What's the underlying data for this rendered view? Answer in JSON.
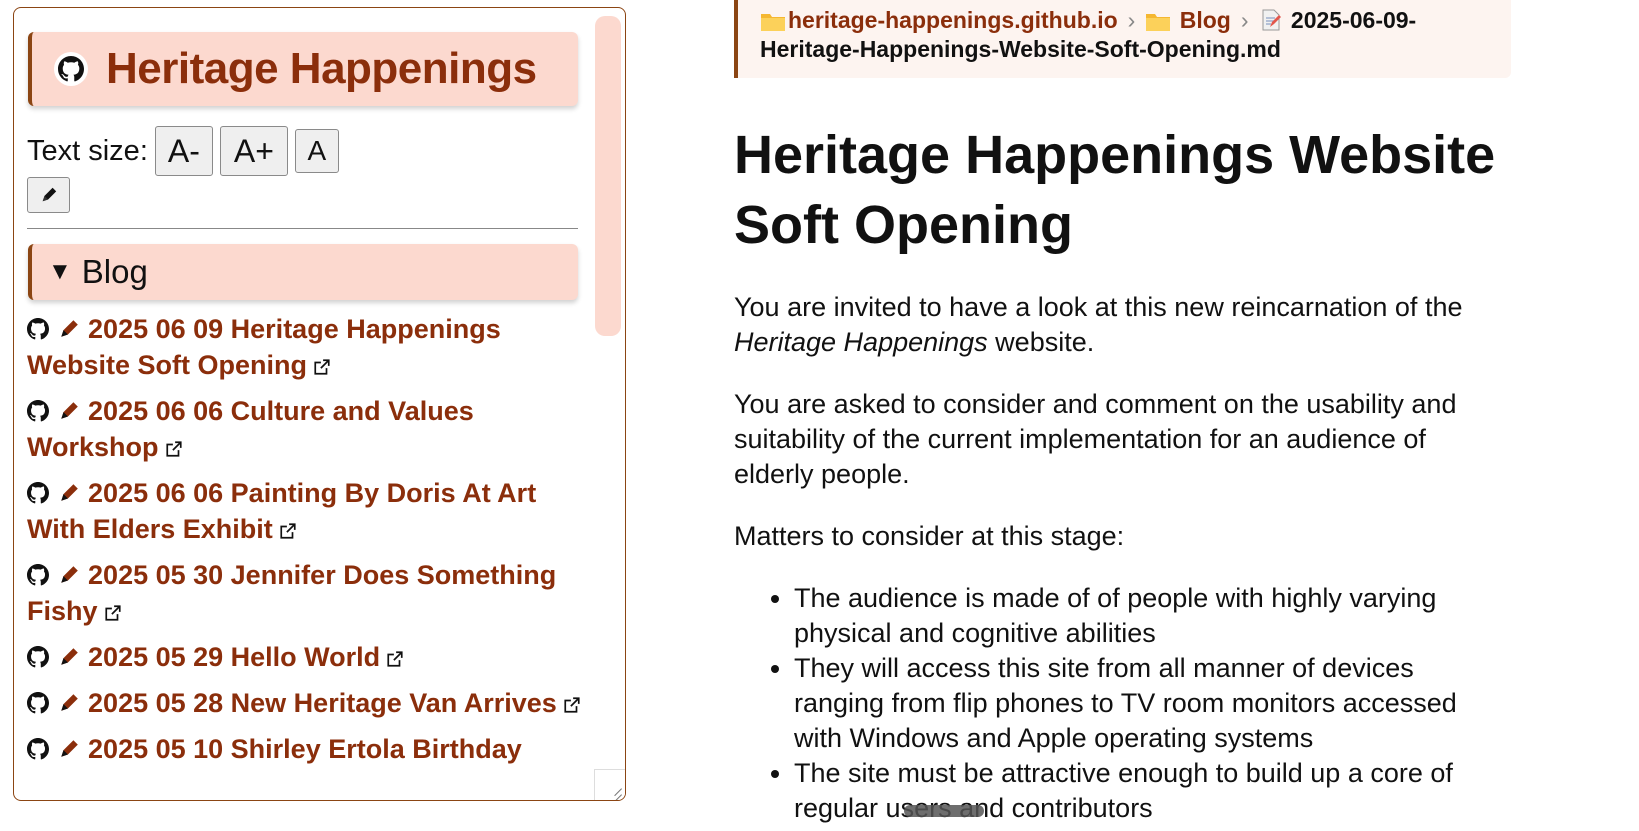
{
  "sidebar": {
    "site_title": "Heritage Happenings",
    "text_size_label": "Text size:",
    "text_size_buttons": {
      "decrease": "A-",
      "increase": "A+",
      "reset": "A"
    },
    "section": {
      "label": "Blog",
      "toggle_glyph": "▼"
    },
    "posts": [
      {
        "title": "2025 06 09 Heritage Happenings Website Soft Opening"
      },
      {
        "title": "2025 06 06 Culture and Values Workshop"
      },
      {
        "title": "2025 06 06 Painting By Doris At Art With Elders Exhibit"
      },
      {
        "title": "2025 05 30 Jennifer Does Something Fishy"
      },
      {
        "title": "2025 05 29 Hello World"
      },
      {
        "title": "2025 05 28 New Heritage Van Arrives"
      },
      {
        "title": "2025 05 10 Shirley Ertola Birthday"
      }
    ]
  },
  "breadcrumb": {
    "repo": "heritage-happenings.github.io",
    "folder": "Blog",
    "separator": "›",
    "file_line1": "2025-06-09-",
    "file_line2": "Heritage-Happenings-Website-Soft-Opening.md"
  },
  "article": {
    "title": "Heritage Happenings Website Soft Opening",
    "p1_text": "You are invited to have a look at this new reincarnation of the",
    "p1_emphasis": "Heritage Happenings",
    "p1_suffix": " website.",
    "p2": "You are asked to consider and comment on the usability and suitability of the current implementation for an audience of elderly people.",
    "p3": "Matters to consider at this stage:",
    "bullets": [
      "The audience is made of of people with highly varying physical and cognitive abilities",
      "They will access this site from all manner of devices ranging from flip phones to TV room monitors accessed with Windows and Apple operating systems",
      "The site must be attractive enough to build up a core of regular users and contributors"
    ]
  },
  "colors": {
    "accent": "#8b2e0b",
    "border": "#8b4513",
    "header_bg": "#fcd9cf",
    "breadcrumb_bg": "#fdf4f0"
  }
}
